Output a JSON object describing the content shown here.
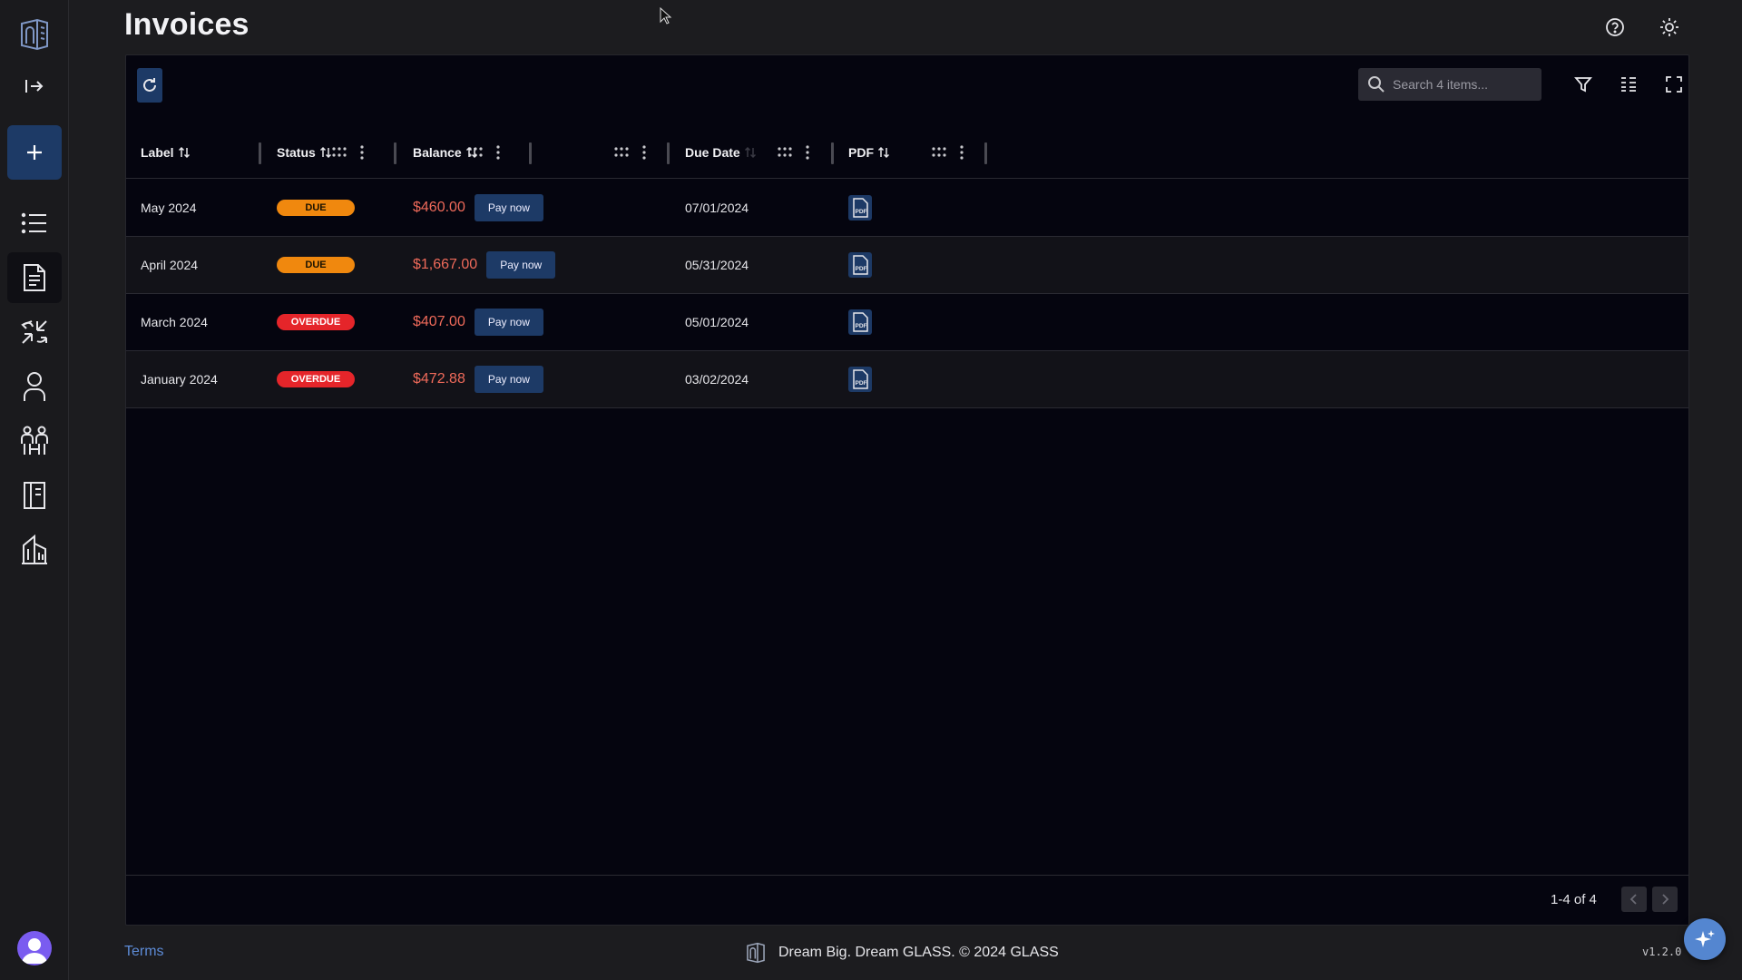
{
  "page": {
    "title": "Invoices"
  },
  "sidebar": {
    "items": [
      {
        "name": "logo"
      },
      {
        "name": "collapse"
      },
      {
        "name": "new"
      },
      {
        "name": "list"
      },
      {
        "name": "invoices",
        "active": true
      },
      {
        "name": "transfers"
      },
      {
        "name": "profile"
      },
      {
        "name": "team"
      },
      {
        "name": "ledger"
      },
      {
        "name": "buildings"
      }
    ]
  },
  "toolbar": {
    "search_placeholder": "Search 4 items..."
  },
  "table": {
    "columns": [
      {
        "label": "Label"
      },
      {
        "label": "Status"
      },
      {
        "label": "Balance"
      },
      {
        "label": "Due Date"
      },
      {
        "label": "PDF"
      }
    ],
    "rows": [
      {
        "label": "May 2024",
        "status": "DUE",
        "status_kind": "due",
        "balance": "$460.00",
        "action": "Pay now",
        "due_date": "07/01/2024"
      },
      {
        "label": "April 2024",
        "status": "DUE",
        "status_kind": "due",
        "balance": "$1,667.00",
        "action": "Pay now",
        "due_date": "05/31/2024"
      },
      {
        "label": "March 2024",
        "status": "OVERDUE",
        "status_kind": "overdue",
        "balance": "$407.00",
        "action": "Pay now",
        "due_date": "05/01/2024"
      },
      {
        "label": "January 2024",
        "status": "OVERDUE",
        "status_kind": "overdue",
        "balance": "$472.88",
        "action": "Pay now",
        "due_date": "03/02/2024"
      }
    ]
  },
  "pagination": {
    "text": "1-4 of 4"
  },
  "footer": {
    "terms": "Terms",
    "tagline": "Dream Big. Dream GLASS. © 2024 GLASS",
    "version": "v1.2.0"
  },
  "colors": {
    "accent": "#1d3a66",
    "due": "#f0880e",
    "overdue": "#e5252a",
    "amount": "#ef6a5a",
    "link": "#5d8bd6"
  }
}
